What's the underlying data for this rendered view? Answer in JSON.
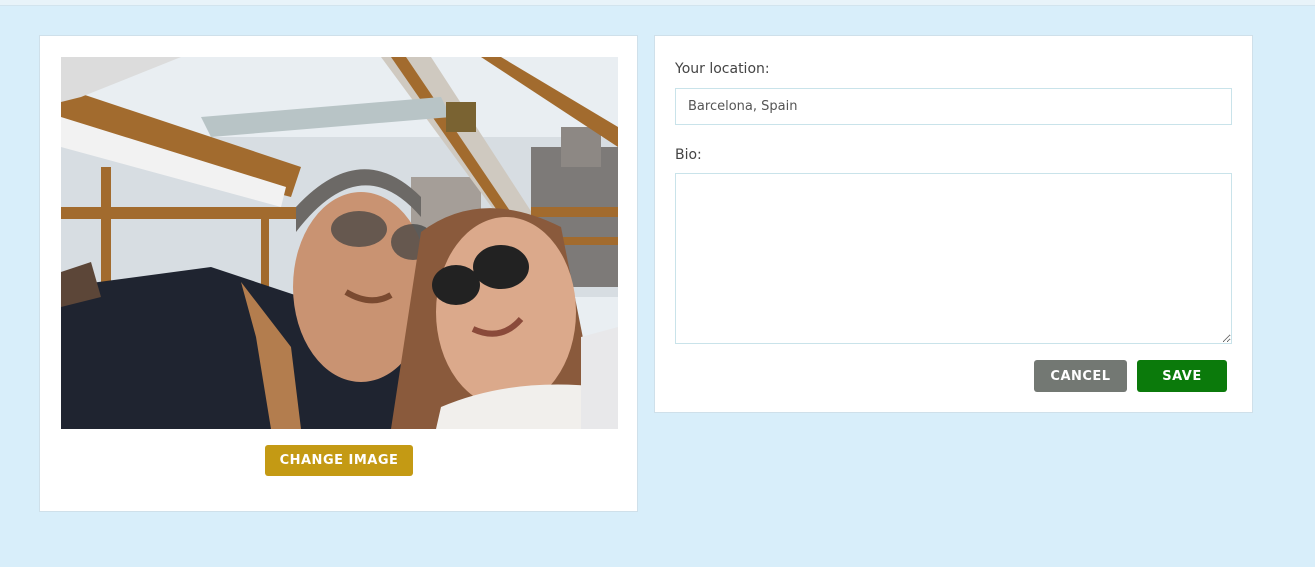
{
  "profile_image": {
    "change_button_label": "CHANGE IMAGE"
  },
  "form": {
    "location_label": "Your location:",
    "location_value": "Barcelona, Spain",
    "bio_label": "Bio:",
    "bio_value": "",
    "cancel_label": "CANCEL",
    "save_label": "SAVE"
  },
  "colors": {
    "page_background": "#d8eefa",
    "change_button": "#c49a14",
    "cancel_button": "#737873",
    "save_button": "#0b7a0b"
  }
}
